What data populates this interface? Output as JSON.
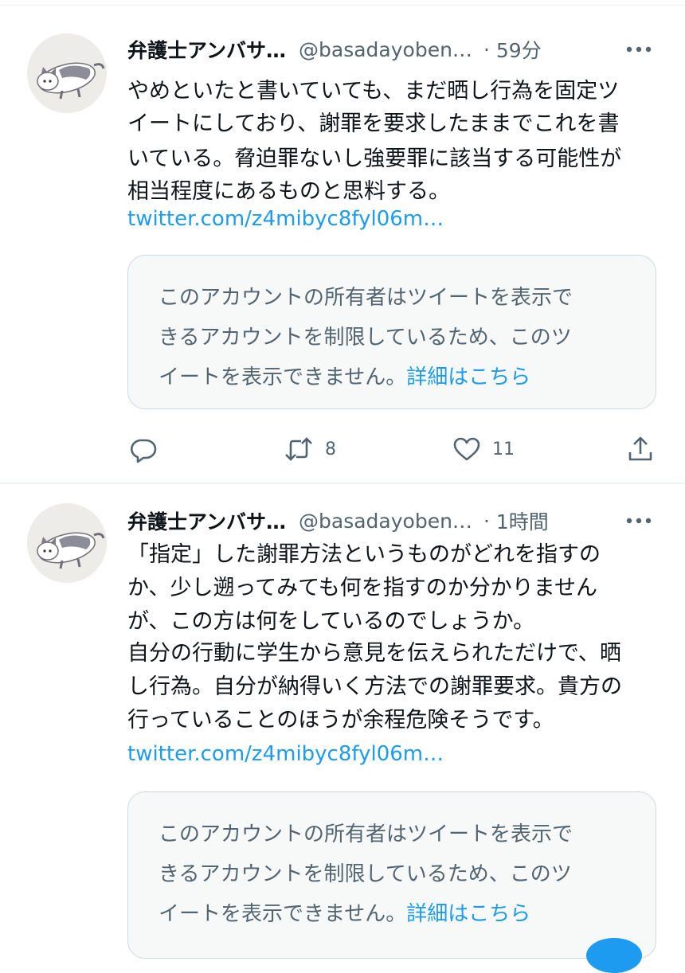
{
  "tweets": [
    {
      "author_name": "弁護士アンバサ…",
      "handle": "@basadayoben…",
      "separator": "·",
      "time": "59分",
      "lines": [
        "やめといたと書いていても、まだ晒し行為を固定ツ",
        "イートにしており、謝罪を要求したままでこれを書",
        "いている。脅迫罪ないし強要罪に該当する可能性が",
        "相当程度にあるものと思料する。"
      ],
      "link": "twitter.com/z4mibyc8fyl06m…",
      "notice": {
        "line1": "このアカウントの所有者はツイートを表示で",
        "line2": "きるアカウントを制限しているため、このツ",
        "line3": "イートを表示できません。",
        "detail_link": "詳細はこちら"
      },
      "retweets": "8",
      "likes": "11"
    },
    {
      "author_name": "弁護士アンバサ…",
      "handle": "@basadayoben…",
      "separator": "·",
      "time": "1時間",
      "lines": [
        "「指定」した謝罪方法というものがどれを指すの",
        "か、少し遡ってみても何を指すのか分かりません",
        "が、この方は何をしているのでしょうか。",
        "自分の行動に学生から意見を伝えられただけで、晒",
        "し行為。自分が納得いく方法での謝罪要求。貴方の",
        "行っていることのほうが余程危険そうです。"
      ],
      "link": "twitter.com/z4mibyc8fyl06m…",
      "notice": {
        "line1": "このアカウントの所有者はツイートを表示で",
        "line2": "きるアカウントを制限しているため、このツ",
        "line3": "イートを表示できません。",
        "detail_link": "詳細はこちら"
      }
    }
  ],
  "colors": {
    "text": "#0f1419",
    "secondary": "#536471",
    "link": "#1d9bf0",
    "border": "#cfd9de",
    "notice_bg": "#f7f9f9",
    "divider": "#eff3f4"
  },
  "icons": [
    "more-icon",
    "reply-icon",
    "retweet-icon",
    "like-icon",
    "share-icon"
  ]
}
